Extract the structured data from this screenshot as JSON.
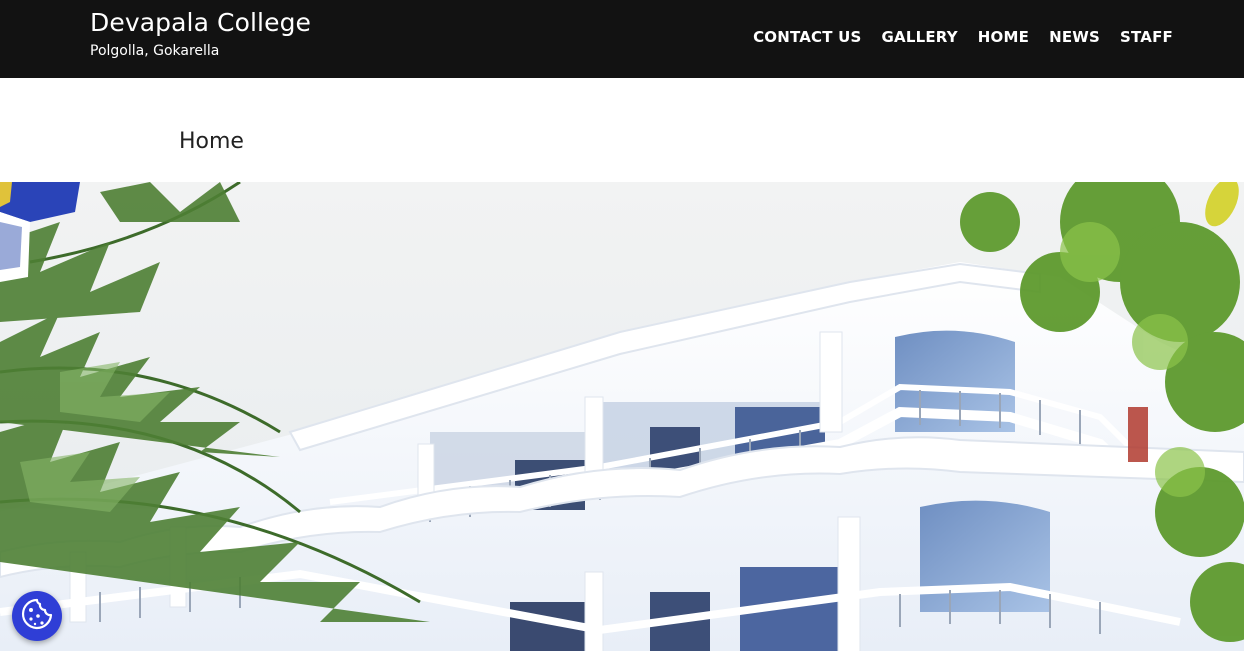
{
  "site": {
    "title": "Devapala College",
    "tagline": "Polgolla, Gokarella"
  },
  "nav": {
    "items": [
      {
        "label": "CONTACT US"
      },
      {
        "label": "GALLERY"
      },
      {
        "label": "HOME"
      },
      {
        "label": "NEWS"
      },
      {
        "label": "STAFF"
      }
    ]
  },
  "page": {
    "title": "Home"
  },
  "colors": {
    "header_bg": "#121212",
    "header_text": "#ffffff",
    "cookie_button": "#2f3ed6"
  },
  "icons": {
    "cookie": "cookie-icon"
  }
}
